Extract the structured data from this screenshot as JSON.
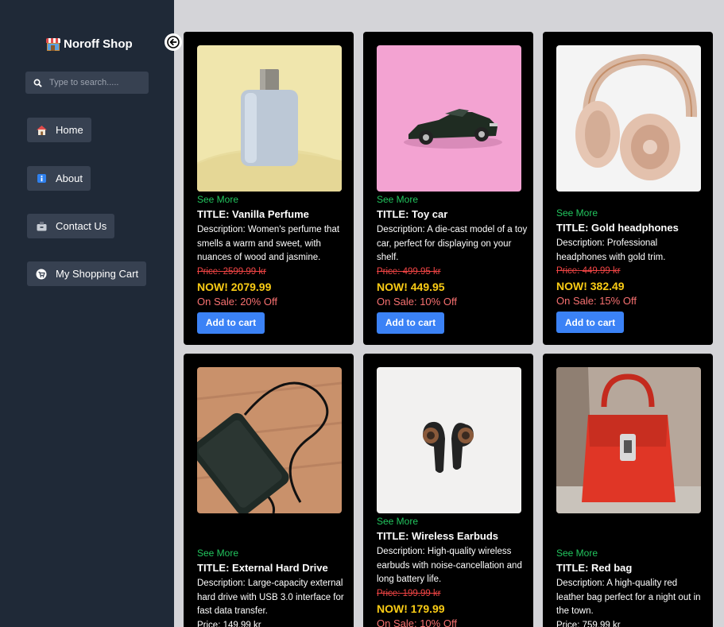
{
  "sidebar": {
    "brand": "Noroff Shop",
    "search_placeholder": "Type to search.....",
    "nav": [
      {
        "label": "Home"
      },
      {
        "label": "About"
      },
      {
        "label": "Contact Us"
      },
      {
        "label": "My Shopping Cart"
      }
    ]
  },
  "products": [
    {
      "see_more": "See More",
      "title": "TITLE: Vanilla Perfume",
      "description": "Description: Women's perfume that smells a warm and sweet, with nuances of wood and jasmine.",
      "old_price": "Price: 2599.99 kr",
      "now_price": "NOW! 2079.99",
      "sale": "On Sale: 20% Off",
      "button": "Add to cart"
    },
    {
      "see_more": "See More",
      "title": "TITLE: Toy car",
      "description": "Description: A die-cast model of a toy car, perfect for displaying on your shelf.",
      "old_price": "Price: 499.95 kr",
      "now_price": "NOW! 449.95",
      "sale": "On Sale: 10% Off",
      "button": "Add to cart"
    },
    {
      "see_more": "See More",
      "title": "TITLE: Gold headphones",
      "description": "Description: Professional headphones with gold trim.",
      "old_price": "Price: 449.99 kr",
      "now_price": "NOW! 382.49",
      "sale": "On Sale: 15% Off",
      "button": "Add to cart"
    },
    {
      "see_more": "See More",
      "title": "TITLE: External Hard Drive",
      "description": "Description: Large-capacity external hard drive with USB 3.0 interface for fast data transfer.",
      "price": "Price: 149.99 kr"
    },
    {
      "see_more": "See More",
      "title": "TITLE: Wireless Earbuds",
      "description": "Description: High-quality wireless earbuds with noise-cancellation and long battery life.",
      "old_price": "Price: 199.99 kr",
      "now_price": "NOW! 179.99",
      "sale": "On Sale: 10% Off"
    },
    {
      "see_more": "See More",
      "title": "TITLE: Red bag",
      "description": "Description: A high-quality red leather bag perfect for a night out in the town.",
      "price": "Price: 759.99 kr"
    }
  ],
  "colors": {
    "sidebar_bg": "#1f2937",
    "page_bg": "#d4d4d8",
    "card_bg": "#000000",
    "see_more": "#22c55e",
    "now_price": "#facc15",
    "old_price": "#ef4444",
    "button": "#3b82f6"
  },
  "icons": {
    "brand": "shop-icon",
    "search": "search-icon",
    "home": "house-icon",
    "about": "info-icon",
    "contact": "mailbox-icon",
    "cart": "shopping-cart-icon",
    "collapse": "arrow-left-icon"
  }
}
